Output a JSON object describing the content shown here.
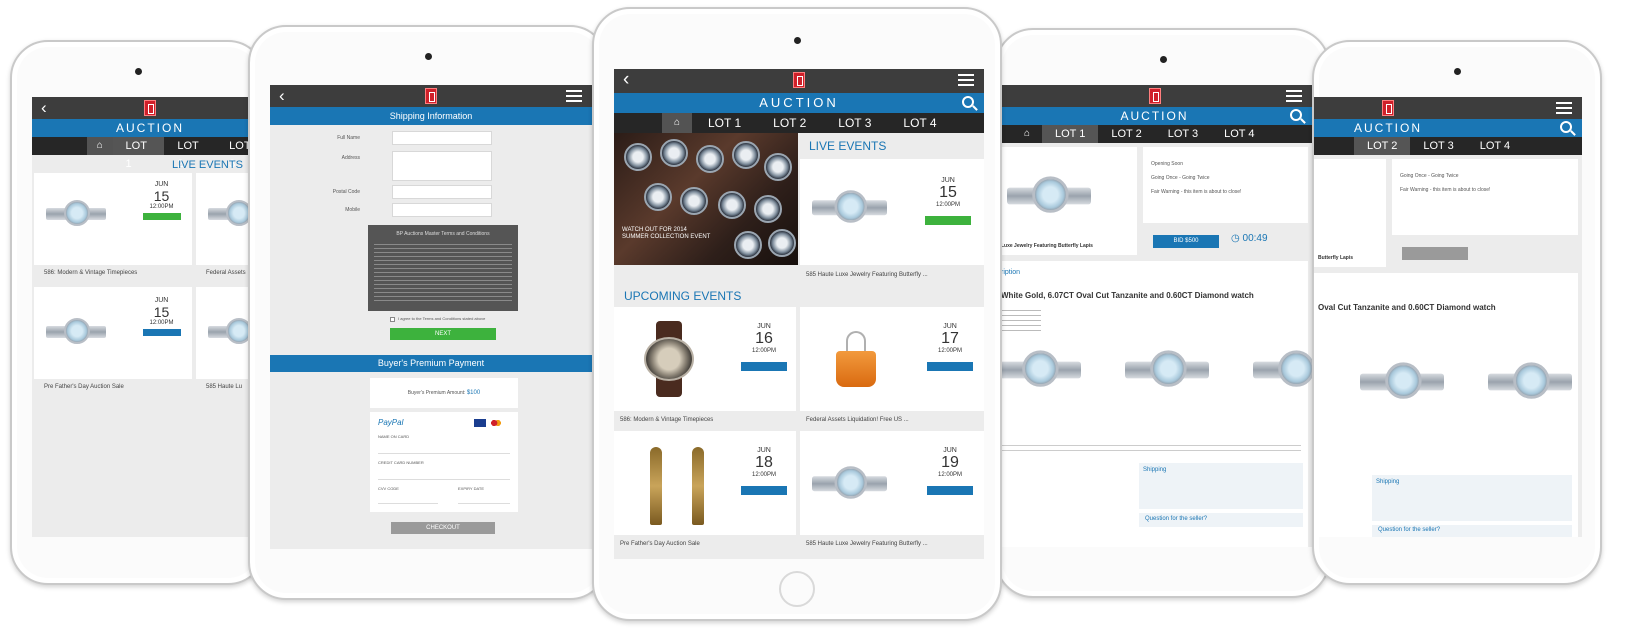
{
  "app": {
    "name": "AUCTION",
    "lots": [
      "LOT 1",
      "LOT 2",
      "LOT 3",
      "LOT 4"
    ]
  },
  "center": {
    "live_events_title": "LIVE EVENTS",
    "upcoming_events_title": "UPCOMING EVENTS",
    "promo_text": "WATCH OUT FOR 2014 SUMMER COLLECTION EVENT",
    "live_card": {
      "month": "JUN",
      "day": "15",
      "time": "12:00PM",
      "caption": "585 Haute Luxe Jewelry Featuring Butterfly ..."
    },
    "upcoming": [
      {
        "month": "JUN",
        "day": "16",
        "time": "12:00PM",
        "caption": "586: Modern & Vintage Timepieces"
      },
      {
        "month": "JUN",
        "day": "17",
        "time": "12:00PM",
        "caption": "Federal Assets Liquidation! Free US ..."
      },
      {
        "month": "JUN",
        "day": "18",
        "time": "12:00PM",
        "caption": "Pre Father's Day Auction Sale"
      },
      {
        "month": "JUN",
        "day": "19",
        "time": "12:00PM",
        "caption": "585 Haute Luxe Jewelry Featuring Butterfly ..."
      }
    ]
  },
  "left": {
    "live_events_title": "LIVE EVENTS",
    "cards": [
      {
        "month": "JUN",
        "day": "15",
        "time": "12:00PM",
        "caption": "586: Modern & Vintage Timepieces"
      },
      {
        "caption": "Federal Assets"
      },
      {
        "month": "JUN",
        "day": "15",
        "time": "12:00PM",
        "caption": "Pre Father's Day Auction Sale"
      },
      {
        "caption": "585 Haute Lu"
      }
    ]
  },
  "shipping": {
    "title": "Shipping Information",
    "fields": [
      "Full Name",
      "Address",
      "Postal Code",
      "Mobile"
    ],
    "terms_title": "BP Auctions Master Terms and Conditions",
    "agree_label": "I agree to the Terms and Conditions stated above",
    "next_label": "NEXT",
    "premium_title": "Buyer's Premium Payment",
    "premium_label": "Buyer's Premium Amount:",
    "premium_amount": "$100",
    "paypal_label": "PayPal",
    "card_name_label": "NAME ON CARD",
    "card_number_label": "CREDIT CARD NUMBER",
    "cvv_label": "CVV CODE",
    "expiry_label": "EXPIRY DATE",
    "checkout_label": "CHECKOUT"
  },
  "detail": {
    "status_items": [
      "Opening Soon",
      "Going Once - Going Twice",
      "Fair Warning - this item is about to close!"
    ],
    "bid_label": "BID $500",
    "countdown": "00:49",
    "lot_title": "Luxe Jewelry Featuring Butterfly Lapis",
    "description_heading": "ription",
    "item_title": "White Gold, 6.07CT Oval Cut Tanzanite and 0.60CT Diamond watch",
    "shipping_label": "Shipping",
    "question_label": "Question for the seller?"
  },
  "right": {
    "status_items": [
      "Going Once - Going Twice",
      "Fair Warning - this item is about to close!"
    ],
    "lot_title": "Butterfly Lapis",
    "item_title": "Oval Cut Tanzanite and 0.60CT Diamond watch",
    "shipping_label": "Shipping",
    "question_label": "Question for the seller?"
  }
}
